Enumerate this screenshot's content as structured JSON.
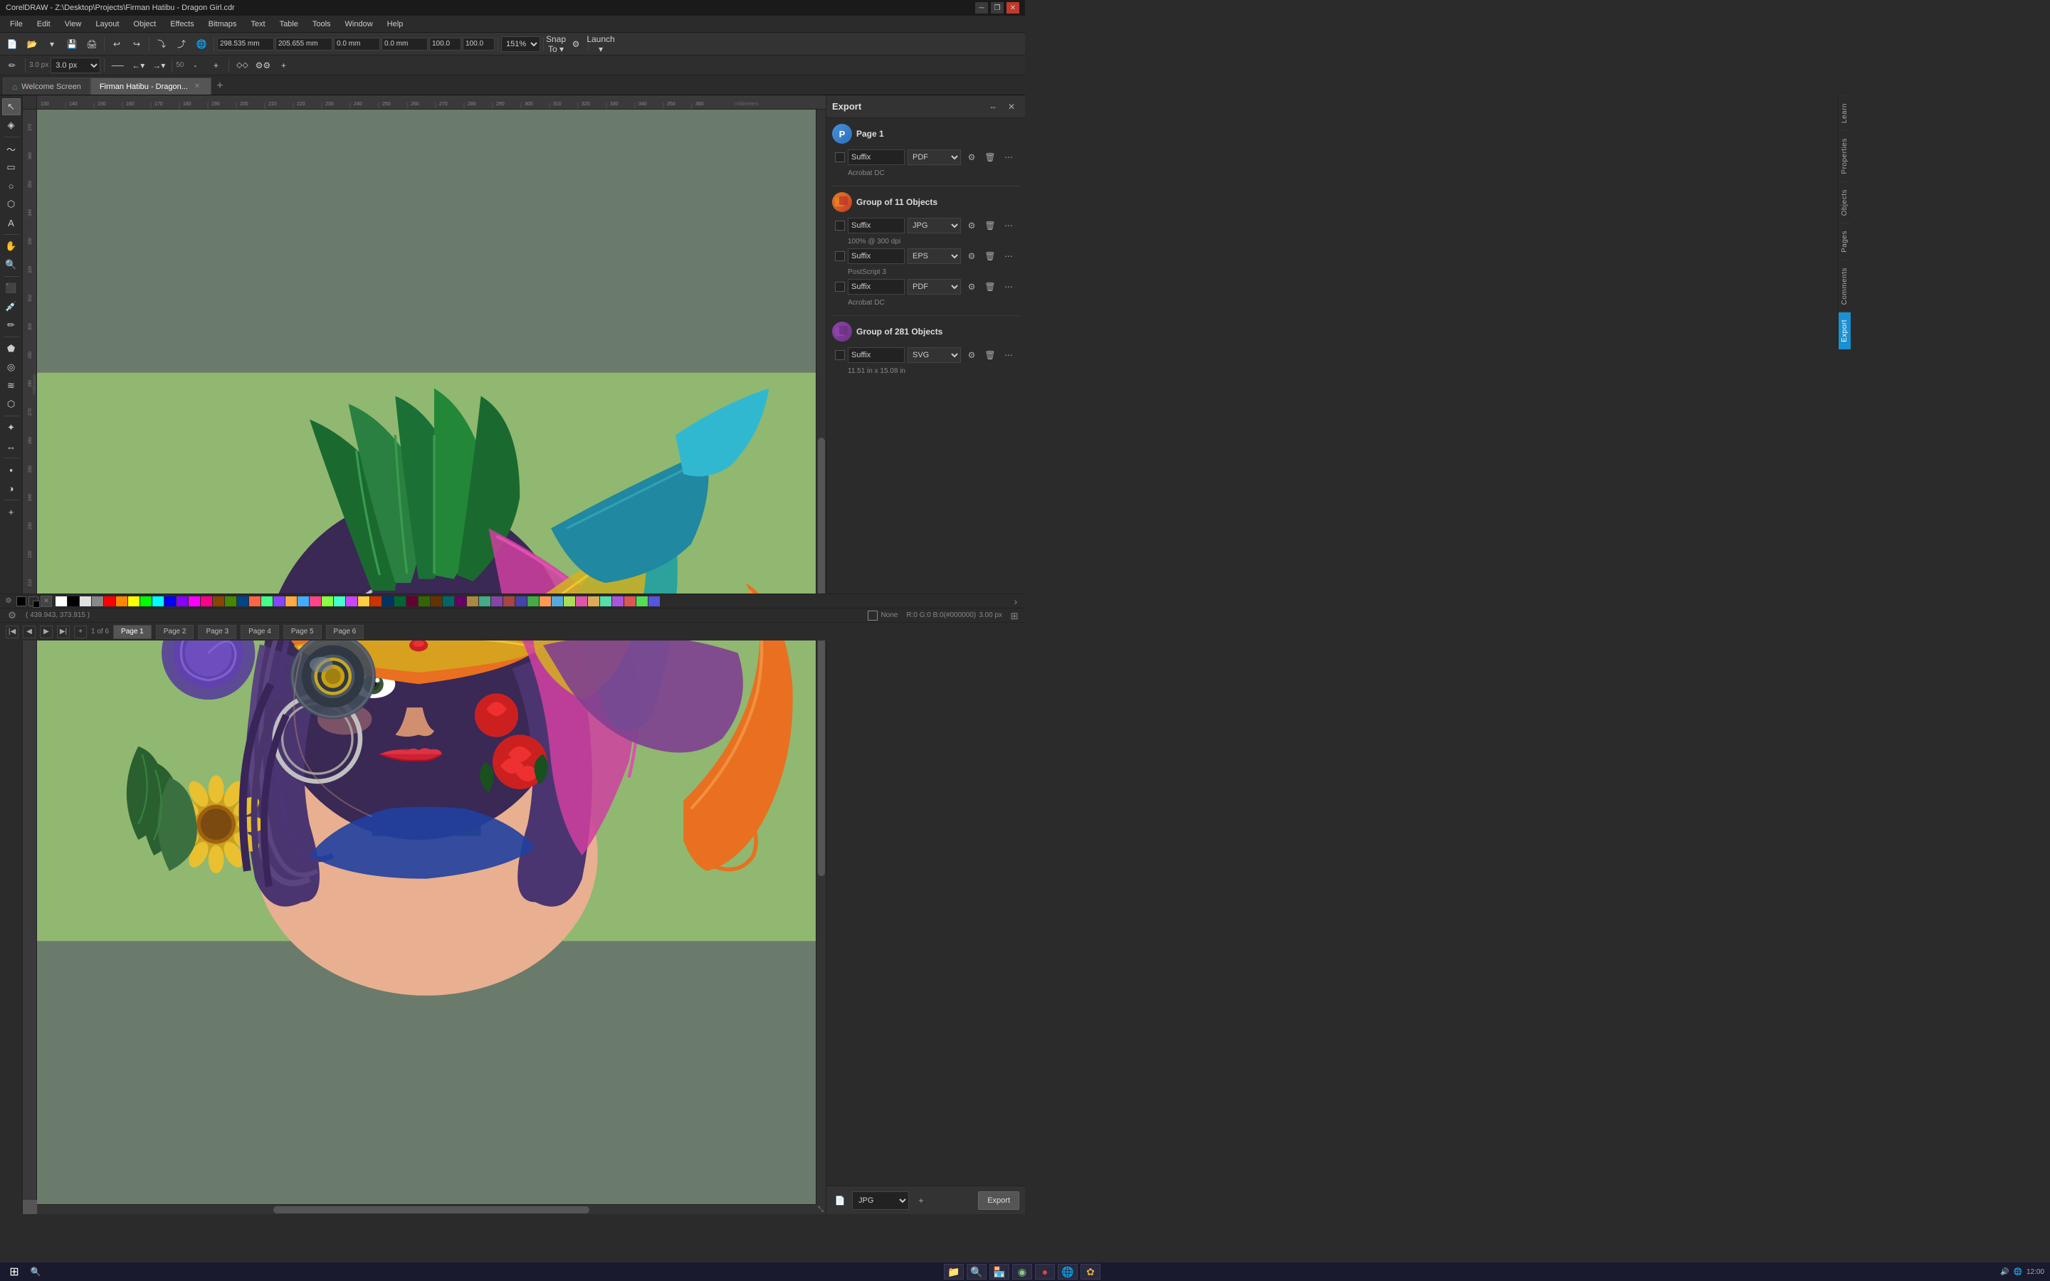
{
  "window": {
    "title": "CorelDRAW - Z:\\Desktop\\Projects\\Firman Hatibu - Dragon Girl.cdr",
    "controls": [
      "minimize",
      "restore",
      "close"
    ]
  },
  "menu": {
    "items": [
      "File",
      "Edit",
      "View",
      "Layout",
      "Object",
      "Effects",
      "Bitmaps",
      "Text",
      "Table",
      "Tools",
      "Window",
      "Help"
    ]
  },
  "toolbar1": {
    "zoom": "151%",
    "snap_to": "Snap To",
    "launch": "Launch"
  },
  "coords": {
    "x": "298.535 mm",
    "y": "205.655 mm",
    "w": "0.0 mm",
    "h": "0.0 mm",
    "w2": "100.0",
    "h2": "100.0"
  },
  "tabs": {
    "welcome": "Welcome Screen",
    "active": "Firman Hatibu - Dragon...",
    "add": "+"
  },
  "canvas": {
    "zoom": "151%",
    "coordinates": "( 439.943, 373.915 )"
  },
  "export_panel": {
    "title": "Export",
    "page": {
      "title": "Page 1",
      "rows": [
        {
          "suffix": "Suffix",
          "format": "PDF",
          "sub_label": "Acrobat DC"
        }
      ]
    },
    "group1": {
      "title": "Group of 11 Objects",
      "rows": [
        {
          "suffix": "Suffix",
          "format": "JPG",
          "sub_label": "100% @ 300 dpi"
        },
        {
          "suffix": "Suffix",
          "format": "EPS",
          "sub_label": "PostScript 3"
        },
        {
          "suffix": "Suffix",
          "format": "PDF",
          "sub_label": "Acrobat DC"
        }
      ]
    },
    "group2": {
      "title": "Group of 281 Objects",
      "rows": [
        {
          "suffix": "Suffix",
          "format": "SVG",
          "sub_label": "11.51 in x 15.08 in"
        }
      ]
    },
    "footer": {
      "format": "JPG",
      "export_label": "Export"
    }
  },
  "side_tabs": [
    "Learn",
    "Properties",
    "Objects",
    "Pages",
    "Comments",
    "Export"
  ],
  "page_nav": {
    "current": "1",
    "total": "6",
    "pages": [
      "Page 1",
      "Page 2",
      "Page 3",
      "Page 4",
      "Page 5",
      "Page 6"
    ]
  },
  "status": {
    "coords": "( 439.943, 373.915 )",
    "fill": "None",
    "stroke": "R:0 G:0 B:0(#000000)",
    "stroke_width": "3.00 px"
  },
  "snap": {
    "pen_size": "3.0 px",
    "smoothing": "50"
  },
  "palette": {
    "colors": [
      "#ffffff",
      "#000000",
      "#ff0000",
      "#00ff00",
      "#0000ff",
      "#ffff00",
      "#ff00ff",
      "#00ffff",
      "#ff8800",
      "#8800ff",
      "#00ff88",
      "#ff0088",
      "#888888",
      "#444444",
      "#cccccc",
      "#ff4444",
      "#44ff44",
      "#4444ff",
      "#ffaa00",
      "#aa00ff",
      "#00ffaa",
      "#ff00aa",
      "#ff6600",
      "#006600",
      "#660000",
      "#000066",
      "#ff9900",
      "#99ff00",
      "#0099ff",
      "#ff0099",
      "#994400",
      "#004499",
      "#449900",
      "#994499",
      "#449944",
      "#999944",
      "#664422",
      "#226644",
      "#224466",
      "#662244",
      "#446622",
      "#466224",
      "#244662",
      "#bb5500",
      "#005588",
      "#558800",
      "#880055",
      "#558855",
      "#885555",
      "#555588",
      "#ddaa00",
      "#00aadd",
      "#aadd00",
      "#dd00aa",
      "#aabb33",
      "#33aabb",
      "#bb33aa"
    ]
  }
}
